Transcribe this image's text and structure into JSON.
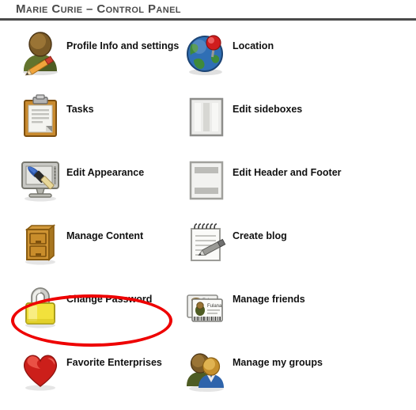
{
  "header": {
    "title": "Marie Curie – Control Panel",
    "divider_color": "#4a4a4a"
  },
  "annotation": {
    "type": "ellipse-highlight",
    "color": "#ee0000",
    "targets": "Change Password"
  },
  "panel": {
    "items": [
      {
        "label": "Profile Info and settings",
        "icon": "user-edit-icon",
        "column": "left",
        "row": 0
      },
      {
        "label": "Location",
        "icon": "globe-pin-icon",
        "column": "right",
        "row": 0
      },
      {
        "label": "Tasks",
        "icon": "clipboard-icon",
        "column": "left",
        "row": 1
      },
      {
        "label": "Edit sideboxes",
        "icon": "columns-layout-icon",
        "column": "right",
        "row": 1
      },
      {
        "label": "Edit Appearance",
        "icon": "monitor-brush-icon",
        "column": "left",
        "row": 2
      },
      {
        "label": "Edit Header and Footer",
        "icon": "page-headfoot-icon",
        "column": "right",
        "row": 2
      },
      {
        "label": "Manage Content",
        "icon": "file-cabinet-icon",
        "column": "left",
        "row": 3
      },
      {
        "label": "Create blog",
        "icon": "notepad-pen-icon",
        "column": "right",
        "row": 3
      },
      {
        "label": "Change Password",
        "icon": "padlock-icon",
        "column": "left",
        "row": 4
      },
      {
        "label": "Manage friends",
        "icon": "id-cards-icon",
        "column": "right",
        "row": 4
      },
      {
        "label": "Favorite Enterprises",
        "icon": "heart-icon",
        "column": "left",
        "row": 5
      },
      {
        "label": "Manage my groups",
        "icon": "users-group-icon",
        "column": "right",
        "row": 5
      }
    ]
  },
  "icon_text": {
    "id_card_name": "Fulana"
  },
  "colors": {
    "highlight": "#ee0000",
    "title": "#4b4b4b",
    "label": "#111111",
    "background": "#ffffff"
  }
}
